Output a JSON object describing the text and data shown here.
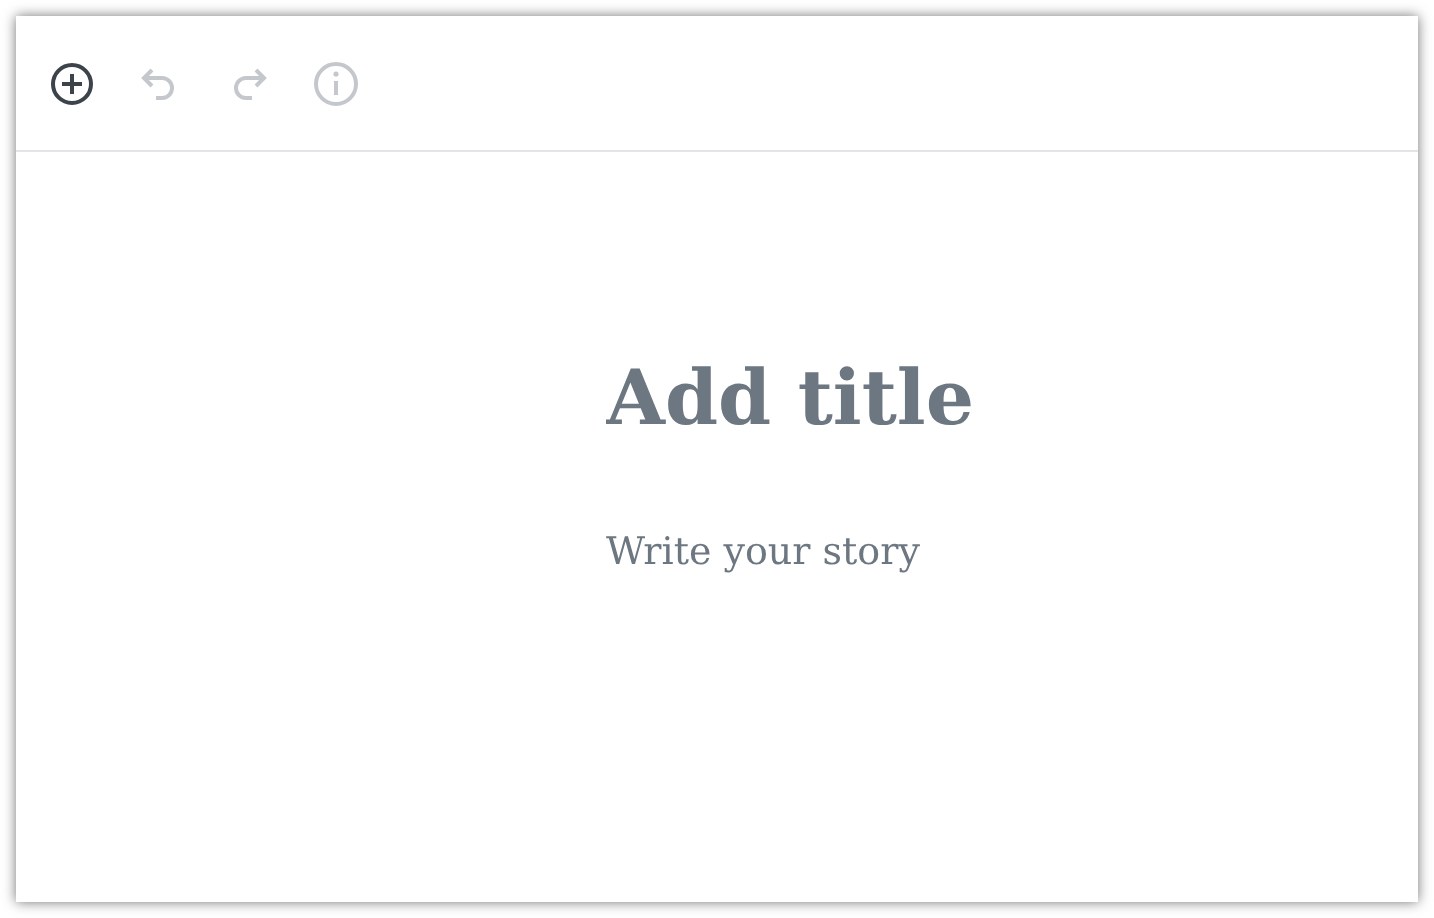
{
  "toolbar": {
    "buttons": [
      {
        "kind": "add",
        "disabled": false
      },
      {
        "kind": "undo",
        "disabled": true
      },
      {
        "kind": "redo",
        "disabled": true
      },
      {
        "kind": "info",
        "disabled": true
      }
    ]
  },
  "editor": {
    "title": {
      "placeholder": "Add title"
    },
    "body": {
      "placeholder": "Write your story"
    }
  }
}
